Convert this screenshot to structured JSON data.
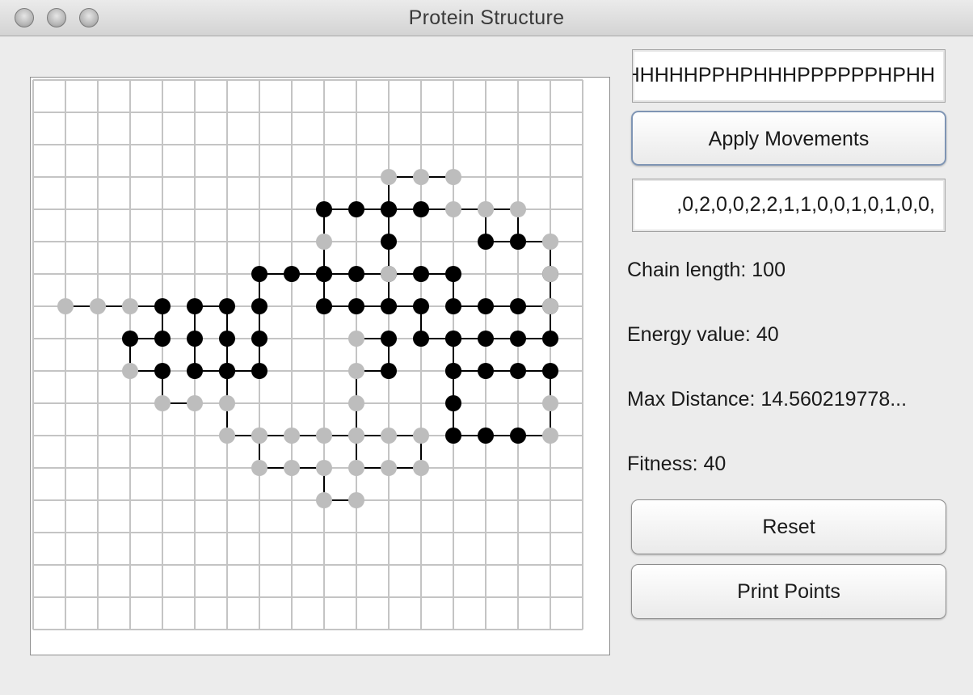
{
  "window": {
    "title": "Protein Structure",
    "buttons": [
      "close-button",
      "minimize-button",
      "zoom-button"
    ]
  },
  "sequence_field": {
    "value": "HHHHHPPHPHHHPPPPPPHPHH"
  },
  "apply_button": {
    "label": "Apply Movements"
  },
  "movements_field": {
    "value": ",0,2,0,0,2,2,1,1,0,0,1,0,1,0,0,"
  },
  "stats": {
    "chain_length": "Chain length: 100",
    "energy": "Energy value: 40",
    "max_distance": "Max Distance: 14.560219778...",
    "fitness": "Fitness: 40"
  },
  "reset_button": {
    "label": "Reset"
  },
  "print_button": {
    "label": "Print Points"
  },
  "lattice": {
    "columns": 17,
    "rows": 17,
    "colors": {
      "H": "#000000",
      "P": "#bdbdbd",
      "bond": "#000000",
      "grid": "#c4c4c4"
    },
    "residues": [
      [
        "P",
        10,
        13
      ],
      [
        "P",
        9,
        13
      ],
      [
        "P",
        9,
        12
      ],
      [
        "P",
        8,
        12
      ],
      [
        "P",
        7,
        12
      ],
      [
        "P",
        7,
        11
      ],
      [
        "P",
        8,
        11
      ],
      [
        "P",
        9,
        11
      ],
      [
        "P",
        10,
        11
      ],
      [
        "P",
        11,
        11
      ],
      [
        "P",
        12,
        11
      ],
      [
        "P",
        12,
        12
      ],
      [
        "P",
        11,
        12
      ],
      [
        "P",
        10,
        12
      ],
      [
        "P",
        10,
        11
      ],
      [
        "P",
        10,
        10
      ],
      [
        "P",
        10,
        9
      ],
      [
        "H",
        11,
        9
      ],
      [
        "H",
        11,
        8
      ],
      [
        "P",
        10,
        8
      ],
      [
        "H",
        11,
        7
      ],
      [
        "H",
        11,
        6
      ],
      [
        "H",
        12,
        6
      ],
      [
        "H",
        13,
        6
      ],
      [
        "H",
        13,
        7
      ],
      [
        "H",
        14,
        7
      ],
      [
        "H",
        15,
        7
      ],
      [
        "H",
        16,
        7
      ],
      [
        "H",
        16,
        6
      ],
      [
        "P",
        16,
        5
      ],
      [
        "P",
        15,
        5
      ],
      [
        "P",
        15,
        4
      ],
      [
        "P",
        14,
        4
      ],
      [
        "P",
        13,
        4
      ],
      [
        "H",
        12,
        4
      ],
      [
        "H",
        11,
        4
      ],
      [
        "H",
        10,
        4
      ],
      [
        "H",
        9,
        4
      ],
      [
        "P",
        9,
        5
      ],
      [
        "H",
        9,
        6
      ],
      [
        "H",
        9,
        7
      ],
      [
        "H",
        10,
        7
      ],
      [
        "H",
        11,
        7
      ],
      [
        "H",
        12,
        7
      ],
      [
        "H",
        12,
        8
      ],
      [
        "H",
        13,
        8
      ],
      [
        "H",
        13,
        9
      ],
      [
        "H",
        14,
        9
      ],
      [
        "H",
        15,
        9
      ],
      [
        "H",
        16,
        9
      ],
      [
        "P",
        16,
        10
      ],
      [
        "P",
        16,
        11
      ],
      [
        "H",
        15,
        11
      ],
      [
        "H",
        14,
        11
      ],
      [
        "H",
        13,
        11
      ],
      [
        "H",
        13,
        10
      ],
      [
        "H",
        13,
        9
      ],
      [
        "H",
        13,
        8
      ],
      [
        "H",
        14,
        8
      ],
      [
        "H",
        15,
        8
      ],
      [
        "H",
        16,
        8
      ],
      [
        "P",
        16,
        7
      ],
      [
        "P",
        16,
        6
      ],
      [
        "P",
        16,
        5
      ],
      [
        "H",
        15,
        5
      ],
      [
        "H",
        14,
        5
      ],
      [
        "P",
        14,
        4
      ],
      [
        "P",
        13,
        3
      ],
      [
        "P",
        12,
        3
      ],
      [
        "P",
        11,
        3
      ],
      [
        "H",
        11,
        4
      ],
      [
        "H",
        11,
        5
      ],
      [
        "P",
        11,
        6
      ],
      [
        "H",
        10,
        6
      ],
      [
        "H",
        9,
        6
      ],
      [
        "H",
        8,
        6
      ],
      [
        "H",
        7,
        6
      ],
      [
        "H",
        7,
        7
      ],
      [
        "H",
        7,
        8
      ],
      [
        "H",
        7,
        9
      ],
      [
        "H",
        6,
        9
      ],
      [
        "H",
        5,
        9
      ],
      [
        "H",
        5,
        8
      ],
      [
        "H",
        5,
        7
      ],
      [
        "H",
        6,
        7
      ],
      [
        "H",
        6,
        8
      ],
      [
        "H",
        6,
        9
      ],
      [
        "P",
        6,
        10
      ],
      [
        "P",
        6,
        11
      ],
      [
        "P",
        7,
        11
      ],
      [
        "P",
        5,
        10
      ],
      [
        "P",
        4,
        10
      ],
      [
        "H",
        4,
        9
      ],
      [
        "P",
        3,
        9
      ],
      [
        "H",
        3,
        8
      ],
      [
        "H",
        4,
        8
      ],
      [
        "H",
        4,
        7
      ],
      [
        "P",
        3,
        7
      ],
      [
        "P",
        2,
        7
      ],
      [
        "P",
        1,
        7
      ]
    ]
  }
}
